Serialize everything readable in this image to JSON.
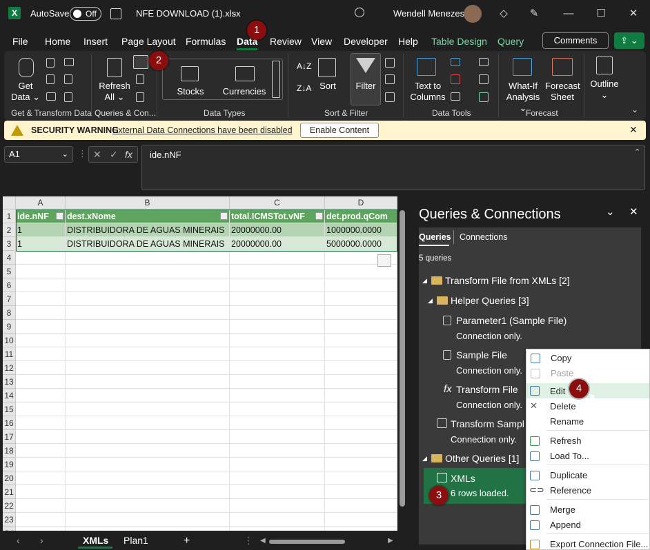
{
  "titlebar": {
    "autosave_label": "AutoSave",
    "autosave_state": "Off",
    "filename": "NFE DOWNLOAD (1).xlsx",
    "user": "Wendell Menezes"
  },
  "tabs": [
    "File",
    "Home",
    "Insert",
    "Page Layout",
    "Formulas",
    "Data",
    "Review",
    "View",
    "Developer",
    "Help",
    "Table Design",
    "Query"
  ],
  "active_tab": "Data",
  "comments_label": "Comments",
  "ribbon": {
    "get_data": "Get Data",
    "refresh_all": "Refresh All",
    "stocks": "Stocks",
    "currencies": "Currencies",
    "sort": "Sort",
    "filter": "Filter",
    "text_to_columns": "Text to Columns",
    "what_if": "What-If Analysis",
    "forecast_sheet": "Forecast Sheet",
    "outline": "Outline",
    "groups": {
      "get_transform": "Get & Transform Data",
      "queries_con": "Queries & Con...",
      "data_types": "Data Types",
      "sort_filter": "Sort & Filter",
      "data_tools": "Data Tools",
      "forecast": "Forecast"
    }
  },
  "security": {
    "title": "SECURITY WARNING",
    "message": "External Data Connections have been disabled",
    "button": "Enable Content"
  },
  "formula_bar": {
    "namebox": "A1",
    "content": "ide.nNF"
  },
  "grid": {
    "columns": [
      "A",
      "B",
      "C",
      "D"
    ],
    "header_row": [
      "ide.nNF",
      "dest.xNome",
      "total.ICMSTot.vNF",
      "det.prod.qCom"
    ],
    "rows": [
      [
        "1",
        "DISTRIBUIDORA DE AGUAS MINERAIS",
        "20000000.00",
        "1000000.0000"
      ],
      [
        "1",
        "DISTRIBUIDORA DE AGUAS MINERAIS",
        "20000000.00",
        "5000000.0000"
      ]
    ],
    "row_numbers": [
      "1",
      "2",
      "3",
      "4",
      "5",
      "6",
      "7",
      "8",
      "9",
      "10",
      "11",
      "12",
      "13",
      "14",
      "15",
      "16",
      "17",
      "18",
      "19",
      "20",
      "21",
      "22",
      "23",
      "24"
    ]
  },
  "sheets": [
    "XMLs",
    "Plan1"
  ],
  "active_sheet": "XMLs",
  "queries_panel": {
    "title": "Queries & Connections",
    "tab_queries": "Queries",
    "tab_connections": "Connections",
    "count": "5 queries",
    "folder1": "Transform File from XMLs",
    "folder1_count": "[2]",
    "folder2": "Helper Queries",
    "folder2_count": "[3]",
    "item_param": "Parameter1 (Sample File)",
    "item_sample": "Sample File",
    "item_transform_file": "Transform File",
    "item_transform_sample": "Transform Sampl",
    "connection_only": "Connection only.",
    "folder3": "Other Queries",
    "folder3_count": "[1]",
    "item_xmls": "XMLs",
    "xmls_status": "6 rows loaded."
  },
  "context_menu": {
    "copy": "Copy",
    "paste": "Paste",
    "edit": "Edit",
    "delete": "Delete",
    "rename": "Rename",
    "refresh": "Refresh",
    "load_to": "Load To...",
    "duplicate": "Duplicate",
    "reference": "Reference",
    "merge": "Merge",
    "append": "Append",
    "export": "Export Connection File..."
  },
  "badges": [
    "1",
    "2",
    "3",
    "4"
  ],
  "colors": {
    "accent": "#107c41",
    "badge": "#8b0d0d",
    "selected": "#217346"
  }
}
